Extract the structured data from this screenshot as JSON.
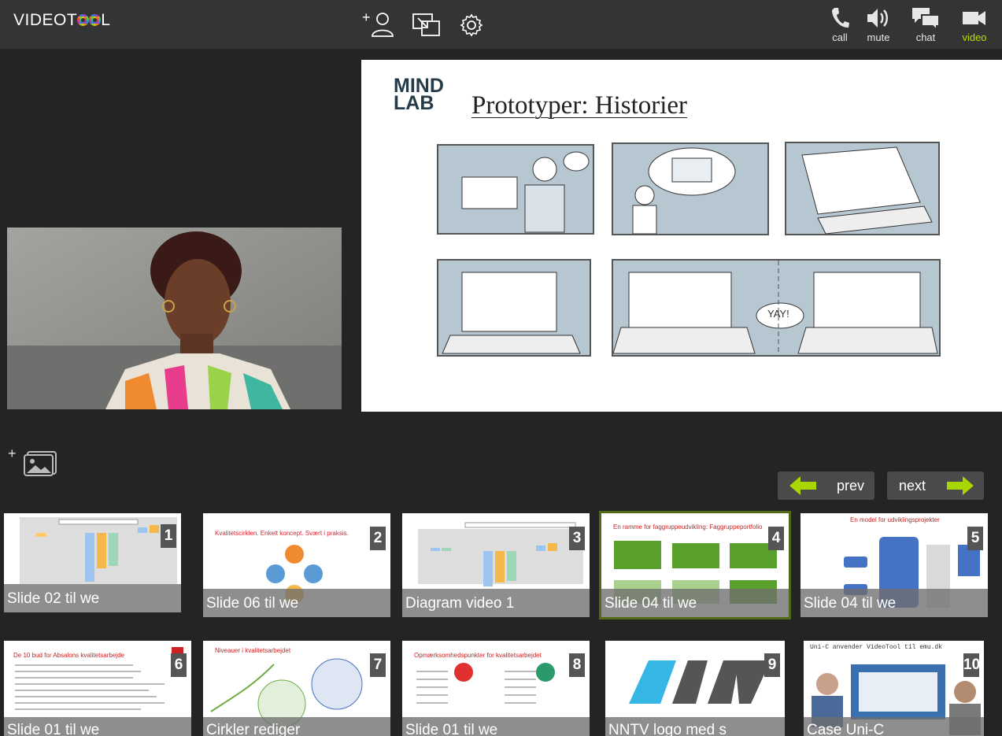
{
  "app": {
    "logo_text_a": "VIDEOT",
    "logo_text_b": "L"
  },
  "toolbar": {
    "call_label": "call",
    "mute_label": "mute",
    "chat_label": "chat",
    "video_label": "video",
    "accent": "#b4e000"
  },
  "presentation": {
    "brand_line1": "MIND",
    "brand_line2": "LAB",
    "title": "Prototyper: Historier",
    "bubble_text": "YAY!"
  },
  "pager": {
    "prev_label": "prev",
    "next_label": "next"
  },
  "slides": [
    {
      "num": "1",
      "caption": "Slide 02 til we"
    },
    {
      "num": "2",
      "caption": "Slide 06 til we",
      "heading": "Kvalitetscirklen. Enkelt koncept. Svært i praksis."
    },
    {
      "num": "3",
      "caption": "Diagram video 1"
    },
    {
      "num": "4",
      "caption": "Slide 04 til we",
      "heading": "En ramme for faggruppeudvikling: Faggruppeportfolio"
    },
    {
      "num": "5",
      "caption": "Slide 04 til we",
      "heading": "En model for udviklingsprojekter"
    },
    {
      "num": "6",
      "caption": "Slide 01 til we",
      "heading": "De 10 bud for Absalons kvalitetsarbejde"
    },
    {
      "num": "7",
      "caption": "Cirkler rediger",
      "heading": "Niveauer i kvalitetsarbejdet"
    },
    {
      "num": "8",
      "caption": "Slide 01 til we",
      "heading": "Opmærksomhedspunkter for kvalitetsarbejdet"
    },
    {
      "num": "9",
      "caption": "NNTV logo med s"
    },
    {
      "num": "10",
      "caption": "Case Uni-C",
      "heading": "Uni-C anvender VideoTool til emu.dk"
    }
  ]
}
